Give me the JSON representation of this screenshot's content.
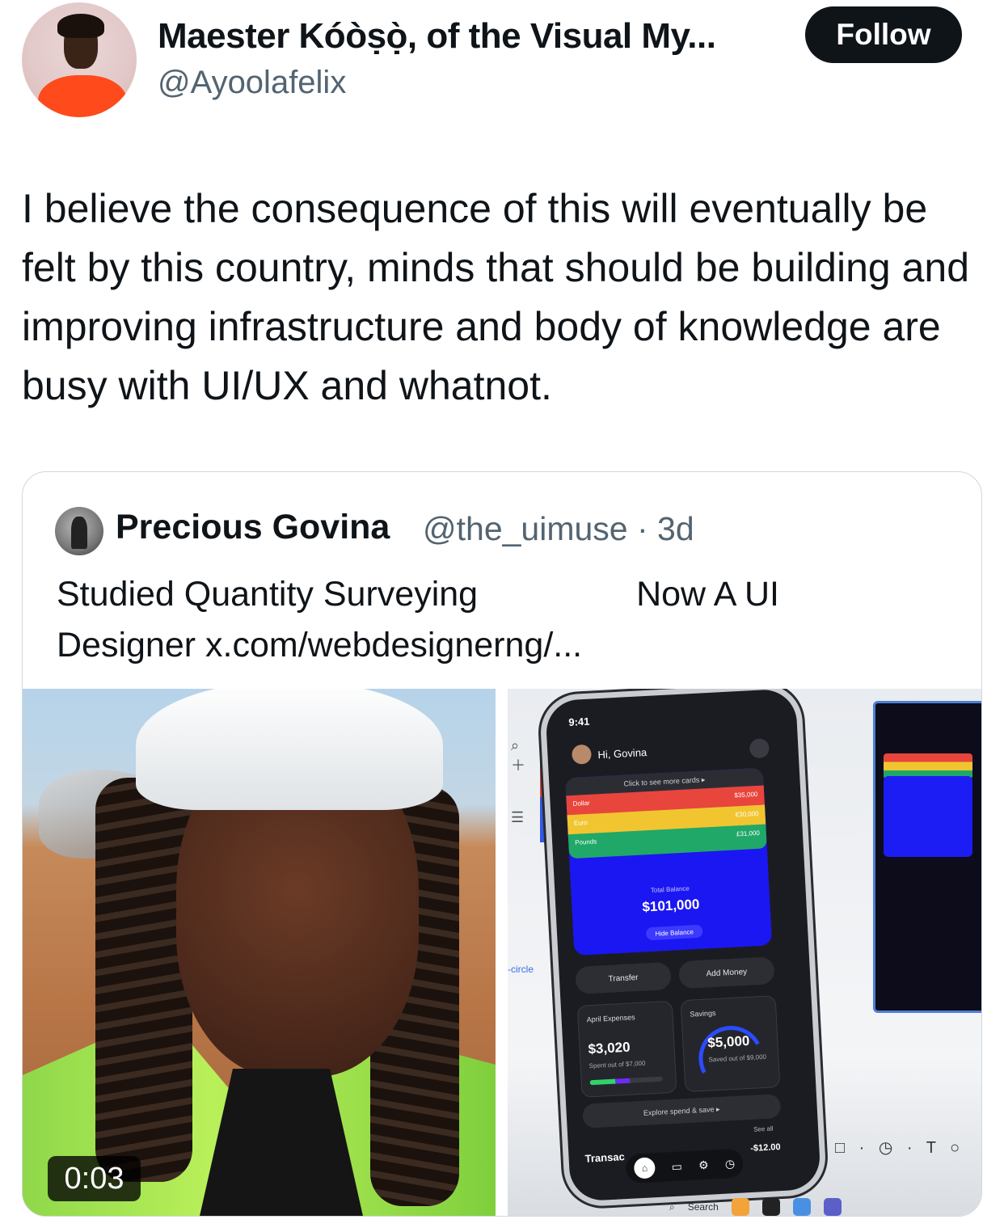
{
  "author": {
    "display_name": "Maester Kóòṣọ̀, of the Visual My...",
    "handle": "@Ayoolafelix",
    "follow_label": "Follow"
  },
  "tweet": {
    "text": "I believe the consequence of this will eventually be felt by this country, minds that should be building and improving infrastructure and body of knowledge are busy with UI/UX and whatnot."
  },
  "quoted_tweet": {
    "display_name": "Precious Govina",
    "handle_time": "@the_uimuse · 3d",
    "text_line1_a": "Studied Quantity Surveying",
    "text_line1_b": "Now A UI",
    "text_line2": "Designer x.com/webdesignerng/...",
    "video_duration": "0:03"
  },
  "phone_mockup": {
    "time": "9:41",
    "greeting": "Hi, Govina",
    "cards_hint": "Click to see more cards  ▸",
    "rows": [
      {
        "label": "Dollar",
        "value": "$35,000",
        "color": "#e8453c"
      },
      {
        "label": "Euro",
        "value": "€30,000",
        "color": "#f0c530"
      },
      {
        "label": "Pounds",
        "value": "£31,000",
        "color": "#20a868"
      }
    ],
    "total_label": "Total Balance",
    "total_value": "$101,000",
    "hide_label": "Hide Balance",
    "transfer_label": "Transfer",
    "add_money_label": "Add Money",
    "expenses_title": "April Expenses",
    "expenses_value": "$3,020",
    "expenses_sub": "Spent out of $7,000",
    "savings_title": "Savings",
    "savings_value": "$5,000",
    "savings_sub": "Saved out of $9,000",
    "explore_label": "Explore spend & save  ▸",
    "see_all": "See all",
    "transactions_label": "Transac",
    "amount": "-$12.00"
  },
  "canvas_labels": {
    "circle": "-circle",
    "toolbar": "□ · ◷ · T ○",
    "search": "Search"
  },
  "colors": {
    "follow_bg": "#0f1419",
    "secondary_text": "#536471",
    "card_blue": "#1b17f2"
  }
}
